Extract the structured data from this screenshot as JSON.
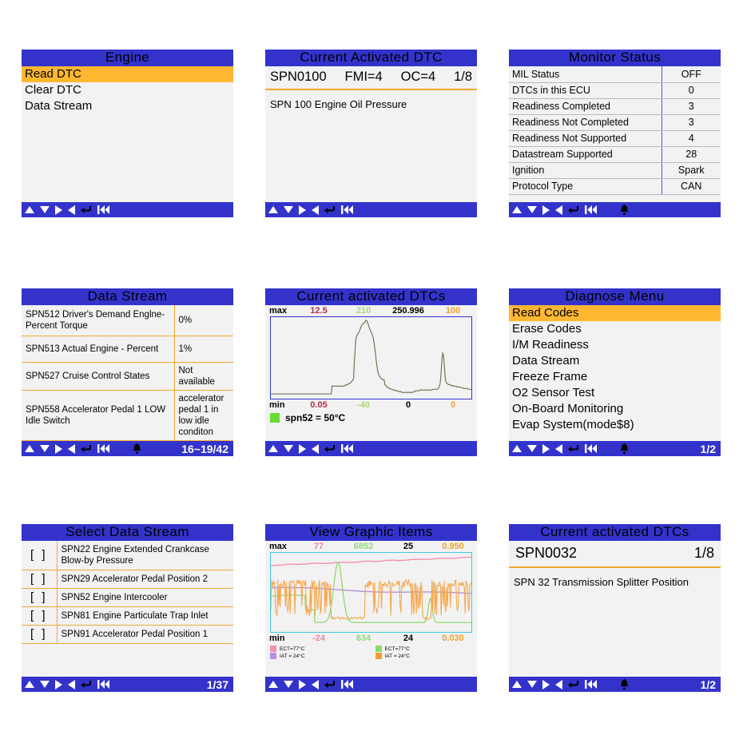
{
  "colors": {
    "header_blue": "#3333cc",
    "highlight_orange": "#ffb732",
    "divider_orange": "#f0a830",
    "screen_bg": "#f2f2f2"
  },
  "nav_icons": [
    "up-arrow",
    "down-arrow",
    "right-arrow",
    "left-arrow",
    "enter-arrow",
    "rewind",
    "bell"
  ],
  "panels": [
    {
      "id": "engine-menu",
      "title": "Engine",
      "type": "menu",
      "items": [
        {
          "label": "Read DTC",
          "selected": true
        },
        {
          "label": "Clear DTC",
          "selected": false
        },
        {
          "label": "Data Stream",
          "selected": false
        }
      ],
      "nav": {
        "bell": false,
        "page": ""
      }
    },
    {
      "id": "current-activated-dtc",
      "title": "Current Activated DTC",
      "type": "dtc",
      "code": "SPN0100",
      "fmi": "FMI=4",
      "oc": "OC=4",
      "index": "1/8",
      "description": "SPN 100 Engine Oil Pressure",
      "nav": {
        "bell": false,
        "page": ""
      }
    },
    {
      "id": "monitor-status",
      "title": "Monitor Status",
      "type": "kv-table",
      "rows": [
        {
          "key": "MIL Status",
          "value": "OFF"
        },
        {
          "key": "DTCs in this ECU",
          "value": "0"
        },
        {
          "key": "Readiness Completed",
          "value": "3"
        },
        {
          "key": "Readiness Not Completed",
          "value": "3"
        },
        {
          "key": "Readiness Not Supported",
          "value": "4"
        },
        {
          "key": "Datastream Supported",
          "value": "28"
        },
        {
          "key": "Ignition",
          "value": "Spark"
        },
        {
          "key": "Protocol Type",
          "value": "CAN"
        }
      ],
      "nav": {
        "bell": true,
        "page": ""
      }
    },
    {
      "id": "data-stream",
      "title": "Data Stream",
      "type": "ds-table",
      "rows": [
        {
          "name": "SPN512 Driver's Demand Englne-Percent Torque",
          "value": "0%"
        },
        {
          "name": "SPN513 Actual Engine - Percent",
          "value": "1%"
        },
        {
          "name": "SPN527 Cruise Control States",
          "value": "Not available"
        },
        {
          "name": "SPN558 Accelerator Pedal 1 LOW Idle Switch",
          "value": "accelerator pedal 1 in low idle conditon"
        }
      ],
      "nav": {
        "bell": true,
        "page": "16~19/42"
      }
    },
    {
      "id": "current-activated-dtcs-graph",
      "title": "Current activated DTCs",
      "type": "graph1",
      "nav": {
        "bell": false,
        "page": ""
      }
    },
    {
      "id": "diagnose-menu",
      "title": "Diagnose Menu",
      "type": "menu",
      "items": [
        {
          "label": "Read Codes",
          "selected": true
        },
        {
          "label": "Erase Codes",
          "selected": false
        },
        {
          "label": "I/M Readiness",
          "selected": false
        },
        {
          "label": "Data Stream",
          "selected": false
        },
        {
          "label": "Freeze Frame",
          "selected": false
        },
        {
          "label": "O2 Sensor Test",
          "selected": false
        },
        {
          "label": "On-Board Monitoring",
          "selected": false
        },
        {
          "label": "Evap System(mode$8)",
          "selected": false
        }
      ],
      "nav": {
        "bell": true,
        "page": "1/2"
      }
    },
    {
      "id": "select-data-stream",
      "title": "Select Data Stream",
      "type": "select-list",
      "checkbox": "[    ]",
      "items": [
        {
          "label": "SPN22 Engine Extended Crankcase Blow-by Pressure"
        },
        {
          "label": "SPN29 Accelerator Pedal Position 2"
        },
        {
          "label": "SPN52 Engine Intercooler"
        },
        {
          "label": "SPN81 Engine Particulate Trap Inlet"
        },
        {
          "label": "SPN91 Accelerator Pedal Position 1"
        }
      ],
      "nav": {
        "bell": false,
        "page": "1/37"
      }
    },
    {
      "id": "view-graphic-items",
      "title": "View Graphic Items",
      "type": "graph4",
      "nav": {
        "bell": false,
        "page": ""
      }
    },
    {
      "id": "current-activated-dtcs-2",
      "title": "Current activated DTCs",
      "type": "dtc2",
      "code": "SPN0032",
      "index": "1/8",
      "description": "SPN 32 Transmission Splitter Position",
      "nav": {
        "bell": true,
        "page": "1/2"
      }
    }
  ],
  "chart_data": [
    {
      "id": "current-activated-dtcs-graph",
      "type": "line",
      "title": "Current activated DTCs",
      "max_label": "max",
      "min_label": "min",
      "max_values": [
        "12.5",
        "210",
        "250.996",
        "100"
      ],
      "min_values": [
        "0.05",
        "-40",
        "0",
        "0"
      ],
      "max_colors": [
        "#b03050",
        "#a8d878",
        "#000000",
        "#f0a030"
      ],
      "min_colors": [
        "#b03050",
        "#a8d878",
        "#000000",
        "#f0a030"
      ],
      "legend": [
        {
          "label": "spn52 = 50°C",
          "color": "#66dd33"
        }
      ],
      "series": [
        {
          "name": "spn52",
          "color": "#6b6b4a",
          "values": [
            6,
            6,
            6,
            6,
            6,
            6,
            6,
            6,
            6,
            6,
            6,
            6,
            6,
            6,
            6,
            6,
            6,
            6,
            6,
            6,
            6,
            6,
            6,
            6,
            6,
            6,
            6,
            6,
            6,
            6,
            6,
            6,
            6,
            6,
            6,
            6,
            6,
            6,
            6,
            6,
            6,
            6,
            6,
            6,
            6,
            6,
            6,
            6,
            6,
            6,
            6,
            6,
            6,
            6,
            6,
            6,
            6,
            6,
            6,
            6,
            6,
            6,
            6,
            6,
            6,
            6,
            6,
            6,
            6,
            6,
            6,
            6,
            6,
            6,
            6,
            6,
            6,
            6,
            6,
            6,
            6,
            6,
            6,
            6,
            6,
            6,
            6,
            6,
            6,
            6,
            6,
            6,
            6,
            6,
            6,
            6,
            16,
            16,
            16,
            16,
            16,
            16,
            16,
            16,
            16,
            16,
            16,
            16,
            16,
            16,
            16,
            16,
            16,
            16,
            16,
            16,
            17,
            17,
            17,
            18,
            18,
            18,
            19,
            19,
            20,
            20,
            21,
            22,
            23,
            24,
            26,
            45,
            58,
            72,
            78,
            80,
            82,
            83,
            84,
            86,
            88,
            90,
            92,
            94,
            95,
            96,
            96,
            97,
            98,
            100,
            100,
            99,
            97,
            95,
            92,
            90,
            88,
            86,
            84,
            82,
            80,
            77,
            72,
            66,
            60,
            52,
            46,
            40,
            35,
            32,
            30,
            28,
            27,
            26,
            25,
            25,
            24,
            24,
            24,
            18,
            17,
            16,
            15,
            15,
            14,
            14,
            13,
            13,
            13,
            12,
            12,
            12,
            11,
            11,
            11,
            11,
            10,
            10,
            10,
            10,
            10,
            9,
            9,
            9,
            9,
            9,
            8,
            8,
            8,
            8,
            8,
            8,
            8,
            8,
            8,
            8,
            8,
            8,
            8,
            8,
            8,
            8,
            8,
            8,
            9,
            9,
            9,
            10,
            10,
            10,
            10,
            10,
            10,
            10,
            11,
            11,
            11,
            11,
            11,
            11,
            11,
            11,
            11,
            11,
            11,
            11,
            11,
            11,
            11,
            11,
            11,
            11,
            11,
            11,
            12,
            12,
            12,
            12,
            12,
            12,
            12,
            12,
            12,
            13,
            14,
            16,
            20,
            28,
            40,
            52,
            58,
            56,
            48,
            36,
            26,
            22,
            20,
            19,
            19,
            18,
            18,
            18,
            17,
            17,
            17,
            17,
            16,
            16,
            16,
            16,
            16,
            16,
            15,
            15,
            15,
            15,
            15,
            15,
            14,
            14,
            14,
            14,
            14,
            13,
            13,
            13,
            13,
            13,
            13,
            13,
            12,
            12,
            12,
            12,
            12,
            12
          ]
        }
      ],
      "grid": false
    },
    {
      "id": "view-graphic-items",
      "type": "line",
      "title": "View Graphic Items",
      "max_label": "max",
      "min_label": "min",
      "max_values": [
        "77",
        "6852",
        "25",
        "0.950"
      ],
      "min_values": [
        "-24",
        "634",
        "24",
        "0.030"
      ],
      "max_colors": [
        "#f283a8",
        "#8fd87a",
        "#000000",
        "#f0a030"
      ],
      "min_colors": [
        "#f283a8",
        "#8fd87a",
        "#000000",
        "#f0a030"
      ],
      "legend": [
        {
          "label": "ECT=77°C",
          "color": "#f48fb1"
        },
        {
          "label": "ECT=77°C",
          "color": "#8fd870"
        },
        {
          "label": "IAT = 24°C",
          "color": "#b48fe0"
        },
        {
          "label": "IAT = 24°C",
          "color": "#f59a2e"
        }
      ],
      "series": [
        {
          "name": "ECT-pink",
          "color": "#f48fb1",
          "values": []
        },
        {
          "name": "IAT-purple",
          "color": "#b48fe0",
          "values": []
        },
        {
          "name": "ECT-green",
          "color": "#8fd870",
          "values": []
        },
        {
          "name": "IAT-orange",
          "color": "#f5a84e",
          "values": []
        }
      ],
      "grid": false
    }
  ]
}
